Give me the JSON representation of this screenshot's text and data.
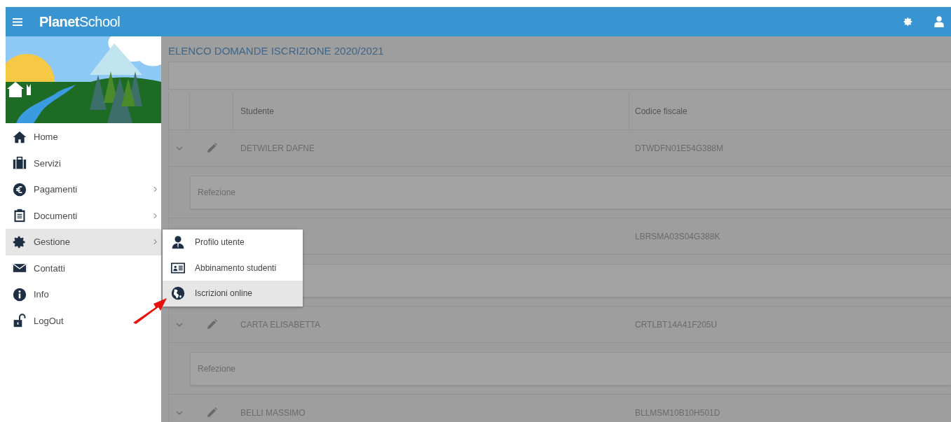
{
  "app_bar": {
    "logo_bold": "Planet",
    "logo_light": "School"
  },
  "sidebar": {
    "items": [
      {
        "label": "Home",
        "has_submenu": false,
        "selected": false
      },
      {
        "label": "Servizi",
        "has_submenu": false,
        "selected": false
      },
      {
        "label": "Pagamenti",
        "has_submenu": true,
        "selected": false
      },
      {
        "label": "Documenti",
        "has_submenu": true,
        "selected": false
      },
      {
        "label": "Gestione",
        "has_submenu": true,
        "selected": true
      },
      {
        "label": "Contatti",
        "has_submenu": false,
        "selected": false
      },
      {
        "label": "Info",
        "has_submenu": false,
        "selected": false
      },
      {
        "label": "LogOut",
        "has_submenu": false,
        "selected": false
      }
    ]
  },
  "submenu": {
    "items": [
      {
        "label": "Profilo utente",
        "selected": false
      },
      {
        "label": "Abbinamento studenti",
        "selected": false
      },
      {
        "label": "Iscrizioni online",
        "selected": true
      }
    ]
  },
  "page_title": "ELENCO DOMANDE ISCRIZIONE 2020/2021",
  "table": {
    "columns": [
      "Studente",
      "Codice fiscale"
    ],
    "rows": [
      {
        "student": "DETWILER DAFNE",
        "tax_code": "DTWDFN01E54G388M",
        "detail": "Refezione"
      },
      {
        "tax_code": "LBRSMA03S04G388K"
      },
      {
        "student": "CARTA ELISABETTA",
        "tax_code": "CRTLBT14A41F205U",
        "detail": "Refezione"
      },
      {
        "student": "BELLI MASSIMO",
        "tax_code": "BLLMSM10B10H501D"
      }
    ]
  }
}
